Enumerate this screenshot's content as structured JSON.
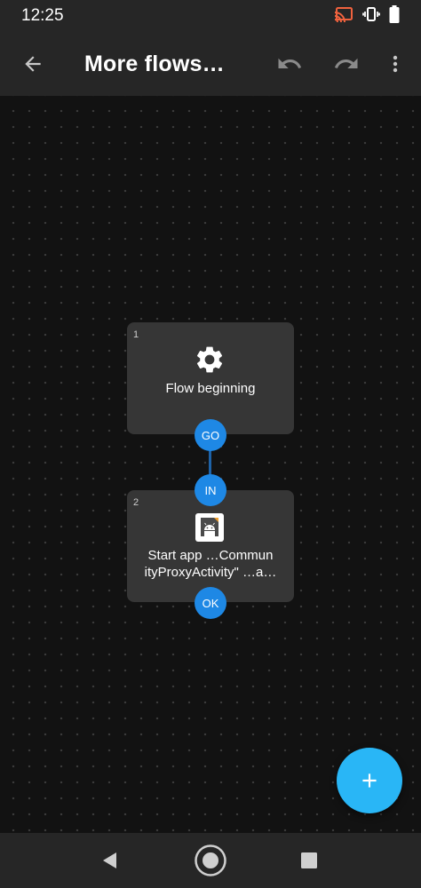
{
  "status_bar": {
    "time": "12:25",
    "icons": [
      "cast-icon",
      "vibrate-icon",
      "battery-icon"
    ]
  },
  "app_bar": {
    "title": "More flows…",
    "back_icon": "arrow-back-icon",
    "undo_icon": "undo-icon",
    "redo_icon": "redo-icon",
    "more_icon": "more-vert-icon"
  },
  "flow": {
    "nodes": [
      {
        "number": "1",
        "icon": "gear-icon",
        "label": "Flow beginning",
        "ports": {
          "out": "GO"
        }
      },
      {
        "number": "2",
        "icon": "android-app-icon",
        "label": "Start app …Community ProxyActivity\" …a…",
        "label_line1": "Start app …Commun",
        "label_line2": "ityProxyActivity\" …a…",
        "ports": {
          "in": "IN",
          "out": "OK"
        }
      }
    ]
  },
  "fab": {
    "icon": "plus-icon"
  },
  "nav_bar": {
    "icons": [
      "nav-back-icon",
      "nav-home-icon",
      "nav-recents-icon"
    ]
  },
  "colors": {
    "app_bar": "#262626",
    "canvas": "#121212",
    "node_card": "#363636",
    "port": "#1e88e5",
    "fab": "#29b6f6"
  }
}
